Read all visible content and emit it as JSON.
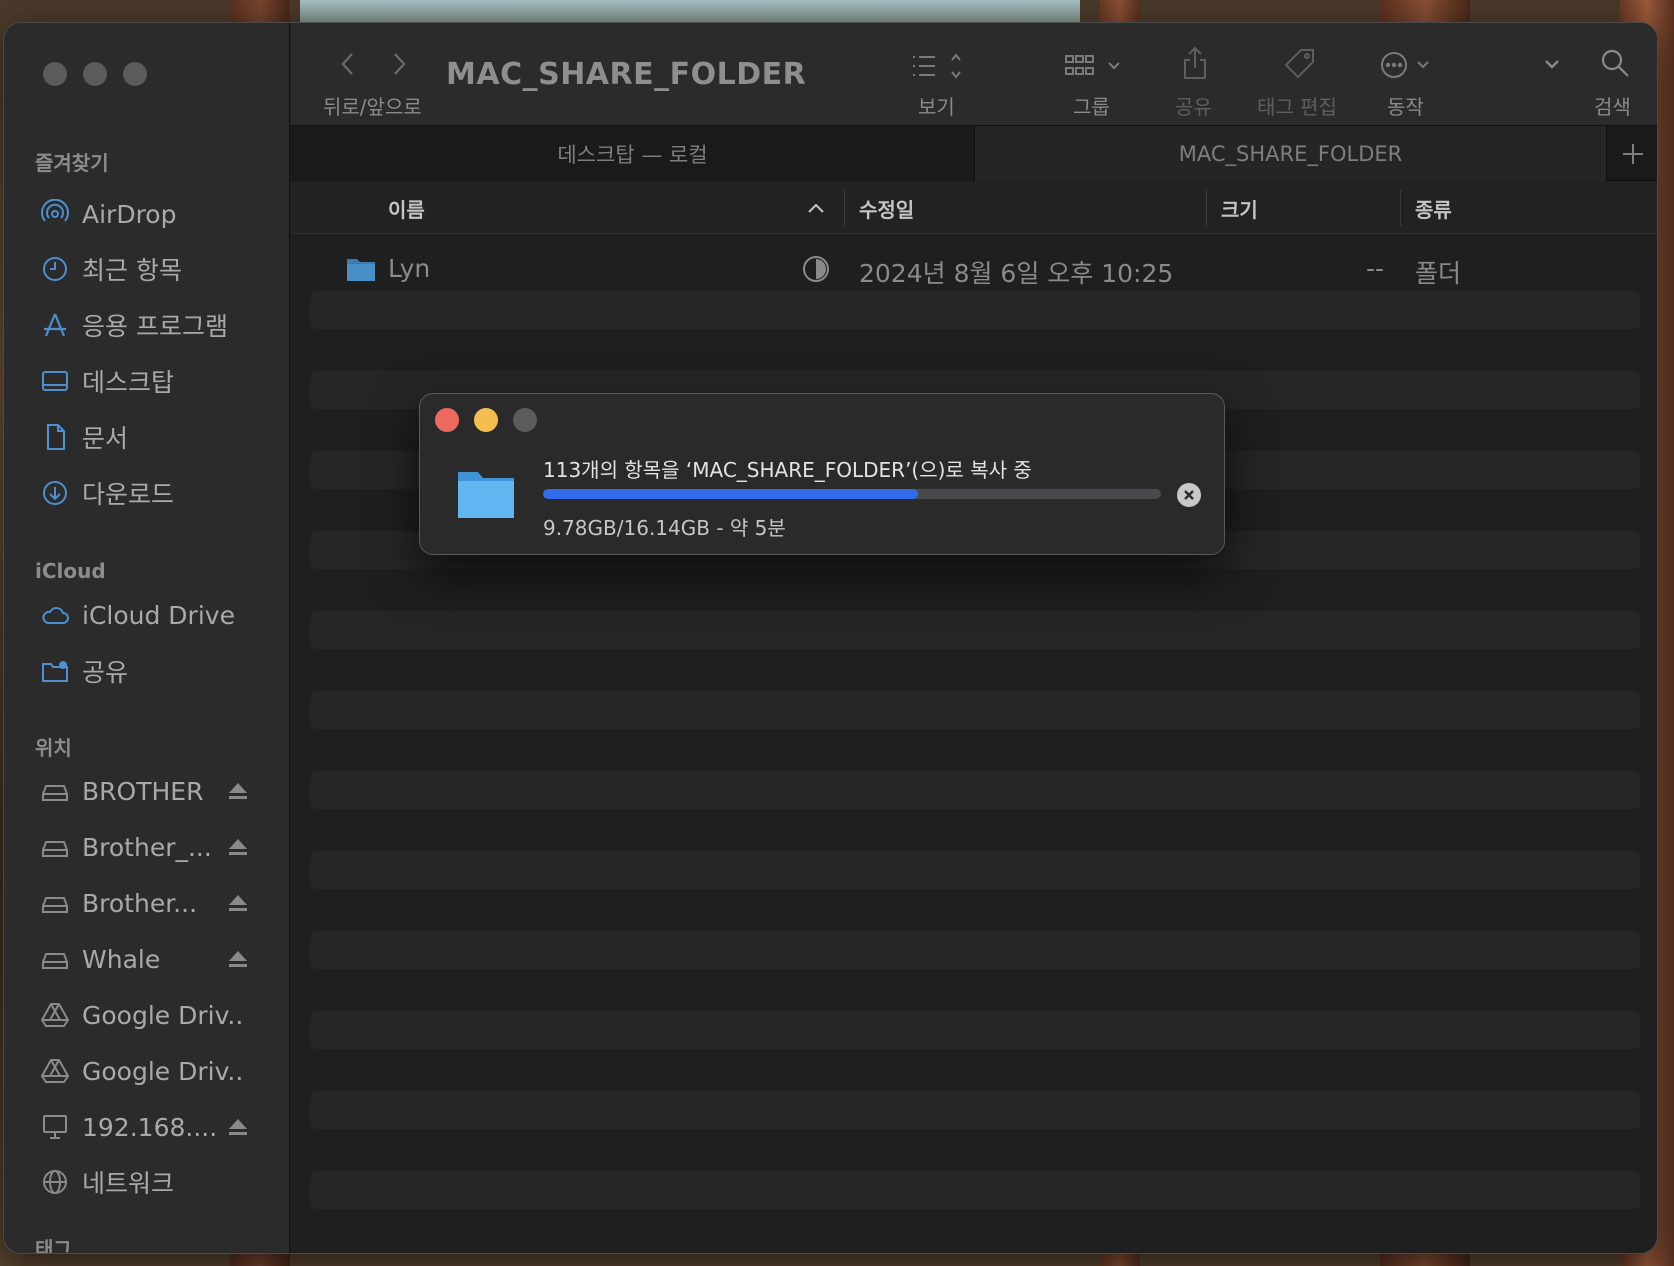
{
  "window": {
    "title": "MAC_SHARE_FOLDER"
  },
  "toolbar": {
    "back_forward_label": "뒤로/앞으로",
    "view_label": "보기",
    "group_label": "그룹",
    "share_label": "공유",
    "tag_edit_label": "태그 편집",
    "action_label": "동작",
    "search_label": "검색"
  },
  "tabs": [
    {
      "label": "데스크탑 — 로컬",
      "active": false
    },
    {
      "label": "MAC_SHARE_FOLDER",
      "active": true
    }
  ],
  "sidebar": {
    "favorites_header": "즐겨찾기",
    "favorites": [
      {
        "label": "AirDrop",
        "icon": "airdrop-icon"
      },
      {
        "label": "최근 항목",
        "icon": "clock-icon"
      },
      {
        "label": "응용 프로그램",
        "icon": "applications-icon"
      },
      {
        "label": "데스크탑",
        "icon": "desktop-icon"
      },
      {
        "label": "문서",
        "icon": "document-icon"
      },
      {
        "label": "다운로드",
        "icon": "download-icon"
      }
    ],
    "icloud_header": "iCloud",
    "icloud": [
      {
        "label": "iCloud Drive",
        "icon": "cloud-icon"
      },
      {
        "label": "공유",
        "icon": "shared-folder-icon"
      }
    ],
    "locations_header": "위치",
    "locations": [
      {
        "label": "BROTHER",
        "icon": "drive-icon",
        "eject": true
      },
      {
        "label": "Brother_...",
        "icon": "drive-icon",
        "eject": true
      },
      {
        "label": "Brother...",
        "icon": "drive-icon",
        "eject": true
      },
      {
        "label": "Whale",
        "icon": "drive-icon",
        "eject": true
      },
      {
        "label": "Google Driv...",
        "icon": "google-drive-icon",
        "eject": false
      },
      {
        "label": "Google Driv...",
        "icon": "google-drive-icon",
        "eject": false
      },
      {
        "label": "192.168....",
        "icon": "computer-icon",
        "eject": true
      },
      {
        "label": "네트워크",
        "icon": "network-icon",
        "eject": false
      }
    ],
    "tags_header": "태그"
  },
  "columns": {
    "name": "이름",
    "modified": "수정일",
    "size": "크기",
    "kind": "종류"
  },
  "files": [
    {
      "name": "Lyn",
      "modified": "2024년 8월 6일 오후 10:25",
      "size": "--",
      "kind": "폴더",
      "icon": "folder-icon"
    }
  ],
  "copy_dialog": {
    "title": "113개의 항목을 ‘MAC_SHARE_FOLDER’(으)로 복사 중",
    "status": "9.78GB/16.14GB - 약 5분",
    "progress": 0.606
  },
  "colors": {
    "accent": "#2f6bea",
    "close": "#ed6a5e",
    "minimize": "#f5bf4f",
    "inactive": "#5b5b5d",
    "folder": "#4aa8e8"
  }
}
